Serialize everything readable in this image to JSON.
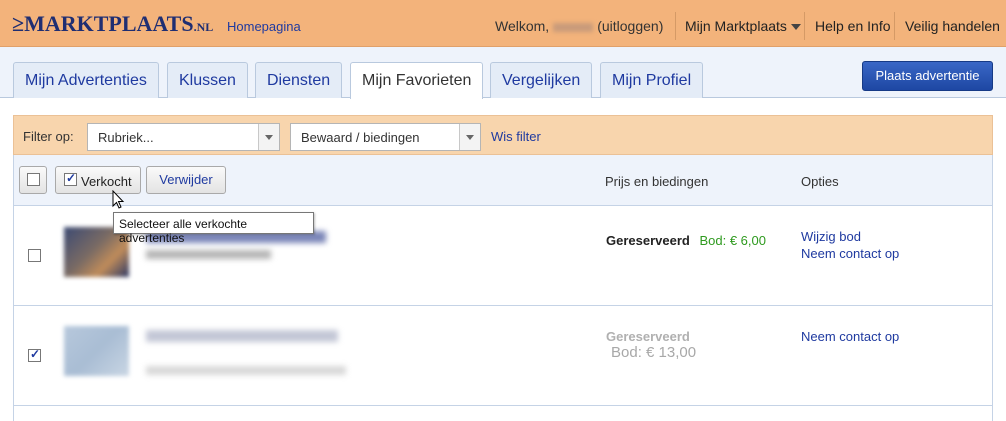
{
  "header": {
    "logo_text": "MARKTPLAATS",
    "logo_suffix": ".NL",
    "home_link": "Homepagina",
    "welcome_prefix": "Welkom,",
    "logout_link": "(uitloggen)",
    "my_marktplaats": "Mijn Marktplaats",
    "help": "Help en Info",
    "safe_trading": "Veilig handelen"
  },
  "tabs": [
    {
      "label": "Mijn Advertenties"
    },
    {
      "label": "Klussen"
    },
    {
      "label": "Diensten"
    },
    {
      "label": "Mijn Favorieten",
      "active": true
    },
    {
      "label": "Vergelijken"
    },
    {
      "label": "Mijn Profiel"
    }
  ],
  "place_ad_button": "Plaats advertentie",
  "filter": {
    "label": "Filter op:",
    "rubriek_value": "Rubriek...",
    "status_value": "Bewaard / biedingen",
    "clear_link": "Wis filter"
  },
  "table_head": {
    "sold_label": "Verkocht",
    "delete_button": "Verwijder",
    "col_price": "Prijs en biedingen",
    "col_options": "Opties"
  },
  "tooltip": "Selecteer alle verkochte advertenties",
  "rows": [
    {
      "status": "Gereserveerd",
      "bid": "Bod: € 6,00",
      "options": [
        "Wijzig bod",
        "Neem contact op"
      ],
      "checked": false
    },
    {
      "status": "Gereserveerd",
      "bid": "Bod: € 13,00",
      "options": [
        "Neem contact op"
      ],
      "checked": true
    }
  ],
  "colors": {
    "header_bg": "#f3b37b",
    "link_blue": "#1f3aa0",
    "bid_green": "#2e9a1e",
    "filter_bg": "#f8d5ad"
  }
}
